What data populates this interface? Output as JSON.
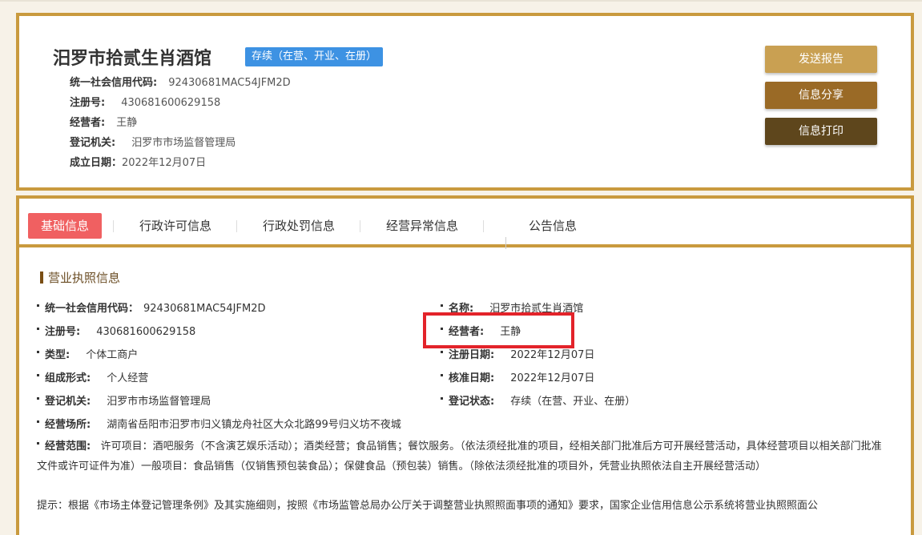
{
  "header": {
    "company_name": "汨罗市拾贰生肖酒馆",
    "status_badge": "存续（在营、开业、在册）",
    "fields": [
      {
        "label": "统一社会信用代码:",
        "value": "92430681MAC54JFM2D"
      },
      {
        "label": "注册号:",
        "value": "430681600629158"
      },
      {
        "label": "经营者:",
        "value": "王静"
      },
      {
        "label": "登记机关:",
        "value": "汨罗市市场监督管理局"
      },
      {
        "label": "成立日期：",
        "value": "2022年12月07日"
      }
    ],
    "buttons": {
      "send": "发送报告",
      "share": "信息分享",
      "print": "信息打印"
    }
  },
  "tabs": [
    {
      "label": "基础信息",
      "active": true
    },
    {
      "label": "行政许可信息"
    },
    {
      "label": "行政处罚信息"
    },
    {
      "label": "经营异常信息"
    },
    {
      "label": "公告信息"
    }
  ],
  "section": {
    "title": "营业执照信息",
    "left": [
      {
        "label": "统一社会信用代码：",
        "value": "92430681MAC54JFM2D"
      },
      {
        "label": "注册号:",
        "value": "430681600629158"
      },
      {
        "label": "类型:",
        "value": "个体工商户"
      },
      {
        "label": "组成形式:",
        "value": "个人经营"
      },
      {
        "label": "登记机关:",
        "value": "汨罗市市场监督管理局"
      },
      {
        "label": "经营场所:",
        "value": "湖南省岳阳市汨罗市归义镇龙舟社区大众北路99号归义坊不夜城"
      }
    ],
    "right": [
      {
        "label": "名称:",
        "value": "汨罗市拾贰生肖酒馆"
      },
      {
        "label": "经营者:",
        "value": "王静"
      },
      {
        "label": "注册日期:",
        "value": "2022年12月07日"
      },
      {
        "label": "核准日期:",
        "value": "2022年12月07日"
      },
      {
        "label": "登记状态:",
        "value": "存续（在营、开业、在册）"
      }
    ],
    "scope_label": "经营范围:",
    "scope_value": "许可项目：酒吧服务（不含演艺娱乐活动）；酒类经营；食品销售；餐饮服务。（依法须经批准的项目，经相关部门批准后方可开展经营活动，具体经营项目以相关部门批准文件或许可证件为准）一般项目：食品销售（仅销售预包装食品）；保健食品（预包装）销售。（除依法须经批准的项目外，凭营业执照依法自主开展经营活动）",
    "tip": "提示：根据《市场主体登记管理条例》及其实施细则，按照《市场监管总局办公厅关于调整营业执照照面事项的通知》要求，国家企业信用信息公示系统将营业执照照面公"
  },
  "colors": {
    "gold_border": "#c99a3e",
    "badge_blue": "#3d92e3",
    "active_tab": "#f06061",
    "highlight_red": "#e3232a"
  }
}
